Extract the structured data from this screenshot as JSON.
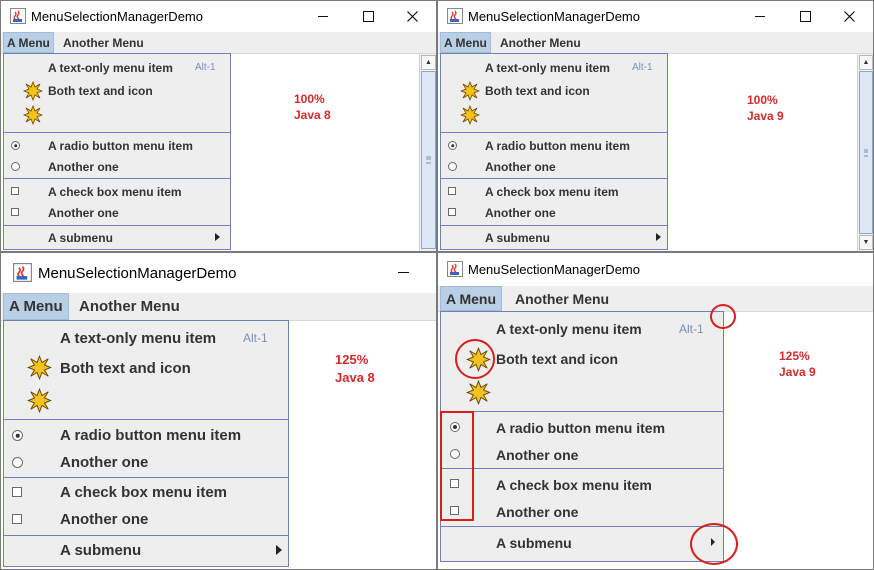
{
  "window_title": "MenuSelectionManagerDemo",
  "menubar": {
    "menu_a": "A Menu",
    "menu_b": "Another Menu"
  },
  "menu_items": {
    "text_only": "A text-only menu item",
    "text_only_accel": "Alt-1",
    "both": "Both text and icon",
    "radio1": "A radio button menu item",
    "radio2": "Another one",
    "check1": "A check box menu item",
    "check2": "Another one",
    "submenu": "A submenu"
  },
  "panels": [
    {
      "id": "p1",
      "scale_label": "100%",
      "java_label": "Java 8"
    },
    {
      "id": "p2",
      "scale_label": "100%",
      "java_label": "Java 9"
    },
    {
      "id": "p3",
      "scale_label": "125%",
      "java_label": "Java 8"
    },
    {
      "id": "p4",
      "scale_label": "125%",
      "java_label": "Java 9"
    }
  ],
  "icons": {
    "app": "java-app-icon",
    "star": "starburst-icon",
    "minimize": "minimize-icon",
    "maximize": "maximize-icon",
    "close": "close-icon",
    "submenu_arrow": "submenu-arrow-icon"
  },
  "colors": {
    "annotation": "#d42a2a",
    "menu_selected_bg": "#b8cfe5",
    "popup_border": "#6c82b8",
    "icon_fill": "#f6c21c"
  }
}
